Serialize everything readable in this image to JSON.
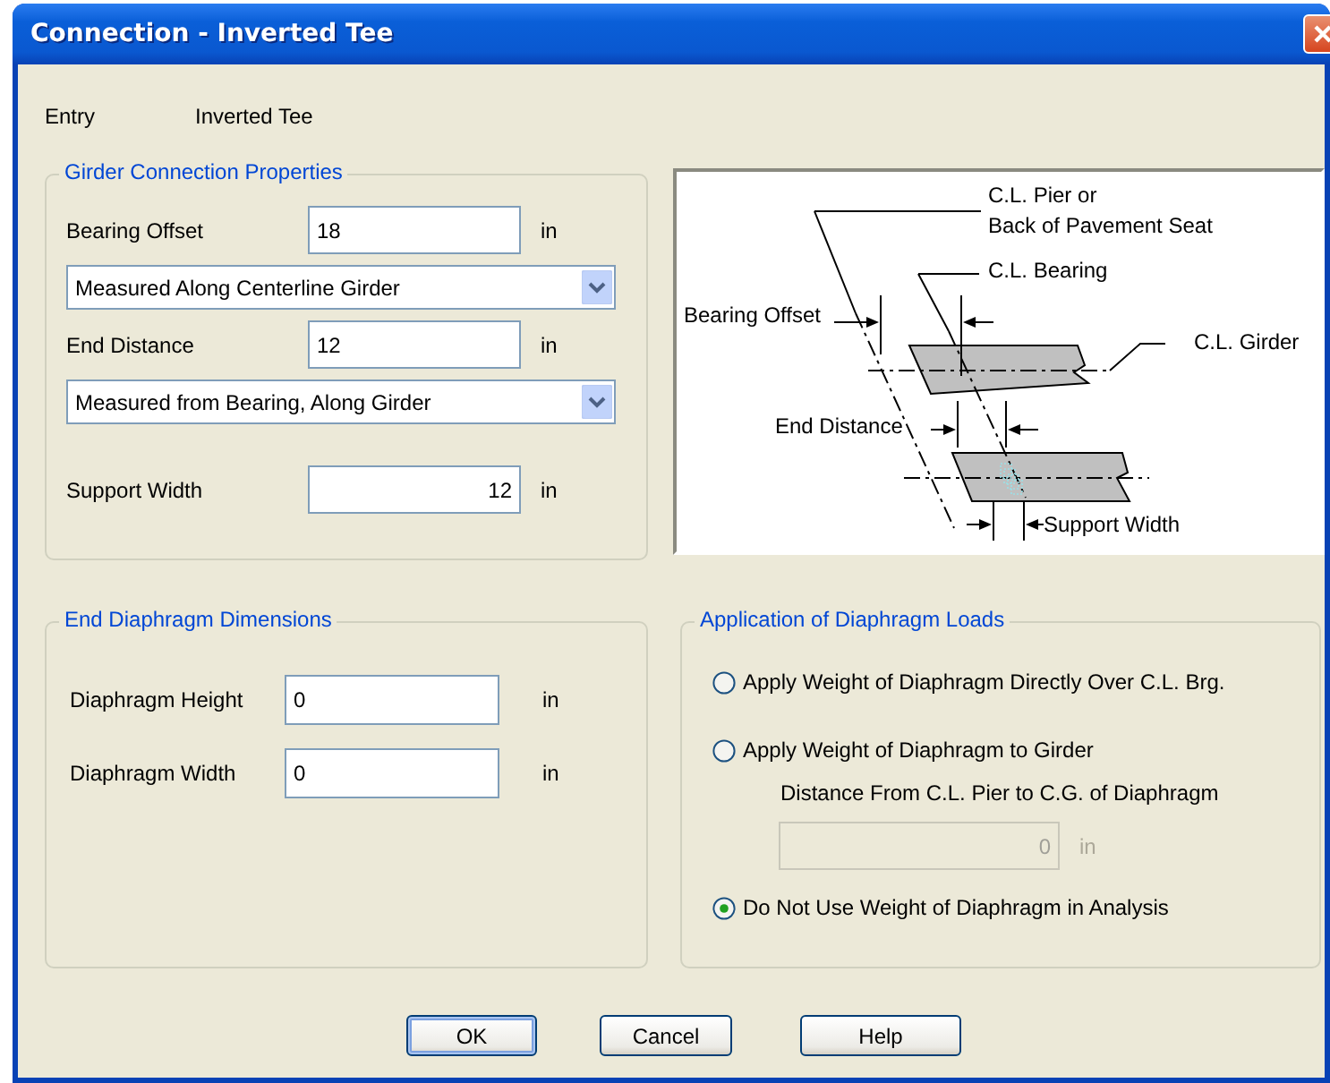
{
  "window": {
    "title": "Connection - Inverted Tee"
  },
  "entry": {
    "label": "Entry",
    "value": "Inverted Tee"
  },
  "girder_connection_properties": {
    "title": "Girder Connection Properties",
    "fields": [
      {
        "kind": "input",
        "label": "Bearing Offset",
        "value": "18",
        "unit": "in"
      },
      {
        "kind": "dropdown",
        "value": "Measured Along Centerline Girder"
      },
      {
        "kind": "input",
        "label": "End Distance",
        "value": "12",
        "unit": "in"
      },
      {
        "kind": "dropdown",
        "value": "Measured from Bearing, Along Girder"
      },
      {
        "kind": "numeric",
        "label": "Support Width",
        "value": "12",
        "unit": "in"
      }
    ]
  },
  "diagram": {
    "labels": [
      "C.L. Pier or",
      "Back of Pavement Seat",
      "C.L. Bearing",
      "Bearing Offset",
      "C.L. Girder",
      "End Distance",
      "Support Width"
    ]
  },
  "end_diaphragm_dimensions": {
    "title": "End Diaphragm Dimensions",
    "fields": [
      {
        "kind": "input",
        "label": "Diaphragm Height",
        "value": "0",
        "unit": "in"
      },
      {
        "kind": "input",
        "label": "Diaphragm Width",
        "value": "0",
        "unit": "in"
      }
    ]
  },
  "application_of_diaphragm_loads": {
    "title": "Application of Diaphragm Loads",
    "options": [
      {
        "label": "Apply Weight of Diaphragm Directly Over C.L. Brg.",
        "selected": false
      },
      {
        "label": "Apply Weight of Diaphragm to Girder",
        "selected": false
      },
      {
        "label": "Do Not Use Weight of Diaphragm in Analysis",
        "selected": true
      }
    ],
    "distance": {
      "label": "Distance From C.L. Pier to C.G. of Diaphragm",
      "value": "0",
      "unit": "in",
      "disabled": true
    }
  },
  "buttons": [
    {
      "label": "OK",
      "default": true
    },
    {
      "label": "Cancel",
      "default": false
    },
    {
      "label": "Help",
      "default": false
    }
  ]
}
